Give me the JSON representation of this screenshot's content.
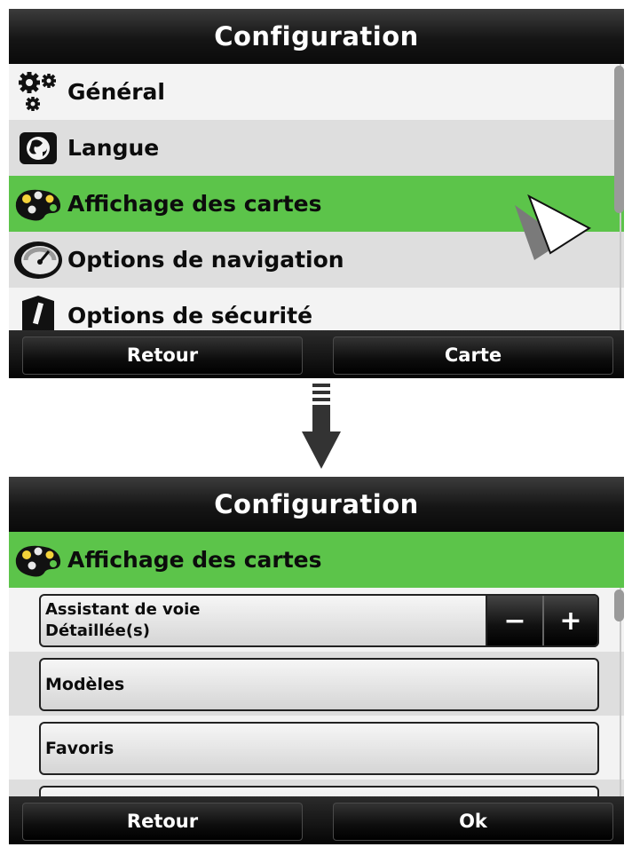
{
  "screen1": {
    "title": "Configuration",
    "items": [
      {
        "label": "Général",
        "icon": "gears-icon"
      },
      {
        "label": "Langue",
        "icon": "globe-icon"
      },
      {
        "label": "Affichage des cartes",
        "icon": "palette-icon",
        "selected": true
      },
      {
        "label": "Options de navigation",
        "icon": "gauge-icon"
      },
      {
        "label": "Options de sécurité",
        "icon": "warning-icon"
      }
    ],
    "back_label": "Retour",
    "map_label": "Carte"
  },
  "screen2": {
    "title": "Configuration",
    "section_label": "Affichage des cartes",
    "settings": [
      {
        "line1": "Assistant de voie",
        "line2": "Détaillée(s)"
      },
      {
        "label": "Modèles"
      },
      {
        "label": "Favoris"
      }
    ],
    "minus_label": "−",
    "plus_label": "+",
    "back_label": "Retour",
    "ok_label": "Ok"
  },
  "colors": {
    "selected_row": "#5cc44a",
    "title_bar": "#151515",
    "row_light": "#f3f3f3",
    "row_gray": "#dedede"
  }
}
